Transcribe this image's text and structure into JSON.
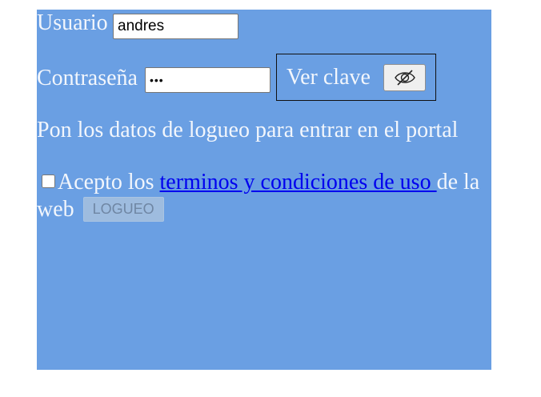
{
  "form": {
    "user_label": "Usuario",
    "user_value": "andres",
    "password_label": "Contraseña",
    "password_value": "abc",
    "show_password_label": "Ver clave",
    "hint": "Pon los datos de logueo para entrar en el portal",
    "terms_prefix": "Acepto los ",
    "terms_link": "terminos y condiciones de uso ",
    "terms_suffix": "de la web",
    "terms_checked": false,
    "login_button": "LOGUEO",
    "login_disabled": true
  },
  "icons": {
    "show_password": "eye-slash-icon"
  },
  "colors": {
    "panel_background": "#6a9fe3",
    "text": "#f2f6fc",
    "link": "#0000ee"
  }
}
